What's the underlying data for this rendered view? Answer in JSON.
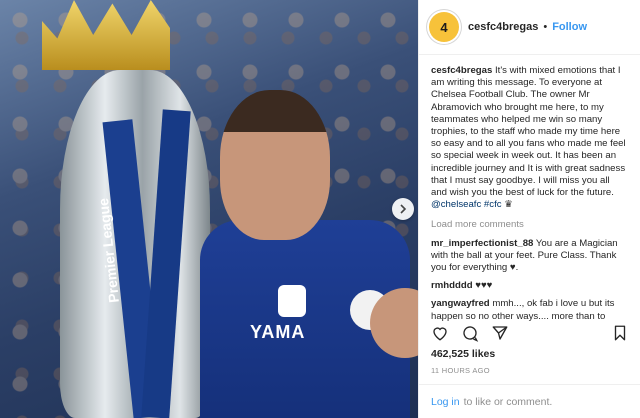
{
  "post": {
    "username": "cesfc4bregas",
    "avatar_text": "4",
    "separator": "•",
    "follow_label": "Follow",
    "caption_user": "cesfc4bregas",
    "caption_text": " It's with mixed emotions that I am writing this message. To everyone at Chelsea Football Club. The owner Mr Abramovich who brought me here, to my teammates who helped me win so many trophies, to the staff who made my time here so easy and to all you fans who made me feel so special week in week out. It has been an incredible journey and It is with great sadness that I must say goodbye. I will miss you all and wish you the best of luck for the future. ",
    "caption_tags": "@chelseafc #cfc",
    "caption_emoji": "♛",
    "view_more": "Load more comments",
    "comments": [
      {
        "user": "mr_imperfectionist_88",
        "text": " You are a Magician with the ball at your feet. Pure Class. Thank you for everything ♥."
      },
      {
        "user": "rmhdddd",
        "text": " ♥♥♥"
      },
      {
        "user": "yangwayfred",
        "text": " mmh..., ok fab i love u but its happen so no other ways.... more than to"
      }
    ],
    "likes": "462,525 likes",
    "time": "11 HOURS AGO",
    "login_label": "Log in",
    "login_suffix": "to like or comment."
  },
  "photo": {
    "ribbon_text": "Premier League",
    "shirt_text": "YAMA"
  },
  "icons": {
    "heart": "heart-icon",
    "comment": "comment-icon",
    "share": "share-icon",
    "bookmark": "bookmark-icon",
    "next": "chevron-right-icon"
  },
  "colors": {
    "link": "#3897f0",
    "tag": "#003569",
    "avatar_bg": "#f7c23a"
  }
}
